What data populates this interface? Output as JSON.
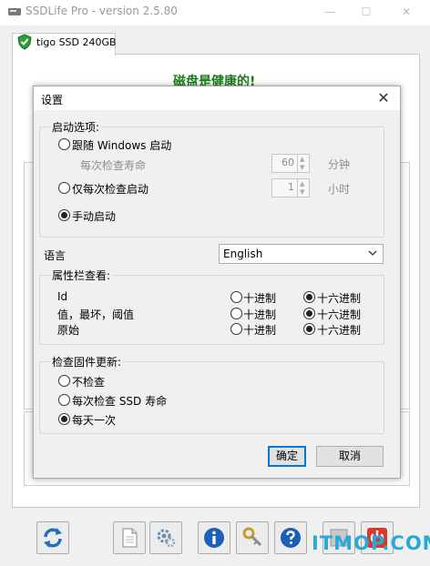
{
  "app": {
    "title": "SSDLife Pro - version 2.5.80",
    "tab_label": "tigo SSD 240GB",
    "status_text": "磁盘是健康的!",
    "status_color": "#1a7f1a",
    "window_controls": [
      "—",
      "☐",
      "✕"
    ]
  },
  "toolbar": {
    "icons": [
      "refresh-icon",
      "document-icon",
      "settings-icon",
      "info-icon",
      "key-icon",
      "help-icon",
      "stop-icon",
      "power-icon"
    ]
  },
  "watermark": {
    "text": "ITMOP.COM"
  },
  "dialog": {
    "title": "设置",
    "close_glyph": "✕",
    "startup": {
      "legend": "启动选项:",
      "with_windows": "跟随 Windows 启动",
      "each_check_life": "每次检查寿命",
      "minutes_value": "60",
      "minutes_unit": "分钟",
      "once_per_check": "仅每次检查启动",
      "hours_value": "1",
      "hours_unit": "小时",
      "manual": "手动启动",
      "selected": "manual"
    },
    "language": {
      "label": "语言",
      "value": "English"
    },
    "attributes": {
      "legend": "属性栏查看:",
      "rows": [
        {
          "label": "Id",
          "decimal": "十进制",
          "hex": "十六进制",
          "selected": "hex"
        },
        {
          "label": "值，最坏，阈值",
          "decimal": "十进制",
          "hex": "十六进制",
          "selected": "hex"
        },
        {
          "label": "原始",
          "decimal": "十进制",
          "hex": "十六进制",
          "selected": "hex"
        }
      ]
    },
    "firmware": {
      "legend": "检查固件更新:",
      "never": "不检查",
      "each_check": "每次检查 SSD 寿命",
      "daily": "每天一次",
      "selected": "daily"
    },
    "ok_label": "确定",
    "cancel_label": "取消"
  }
}
